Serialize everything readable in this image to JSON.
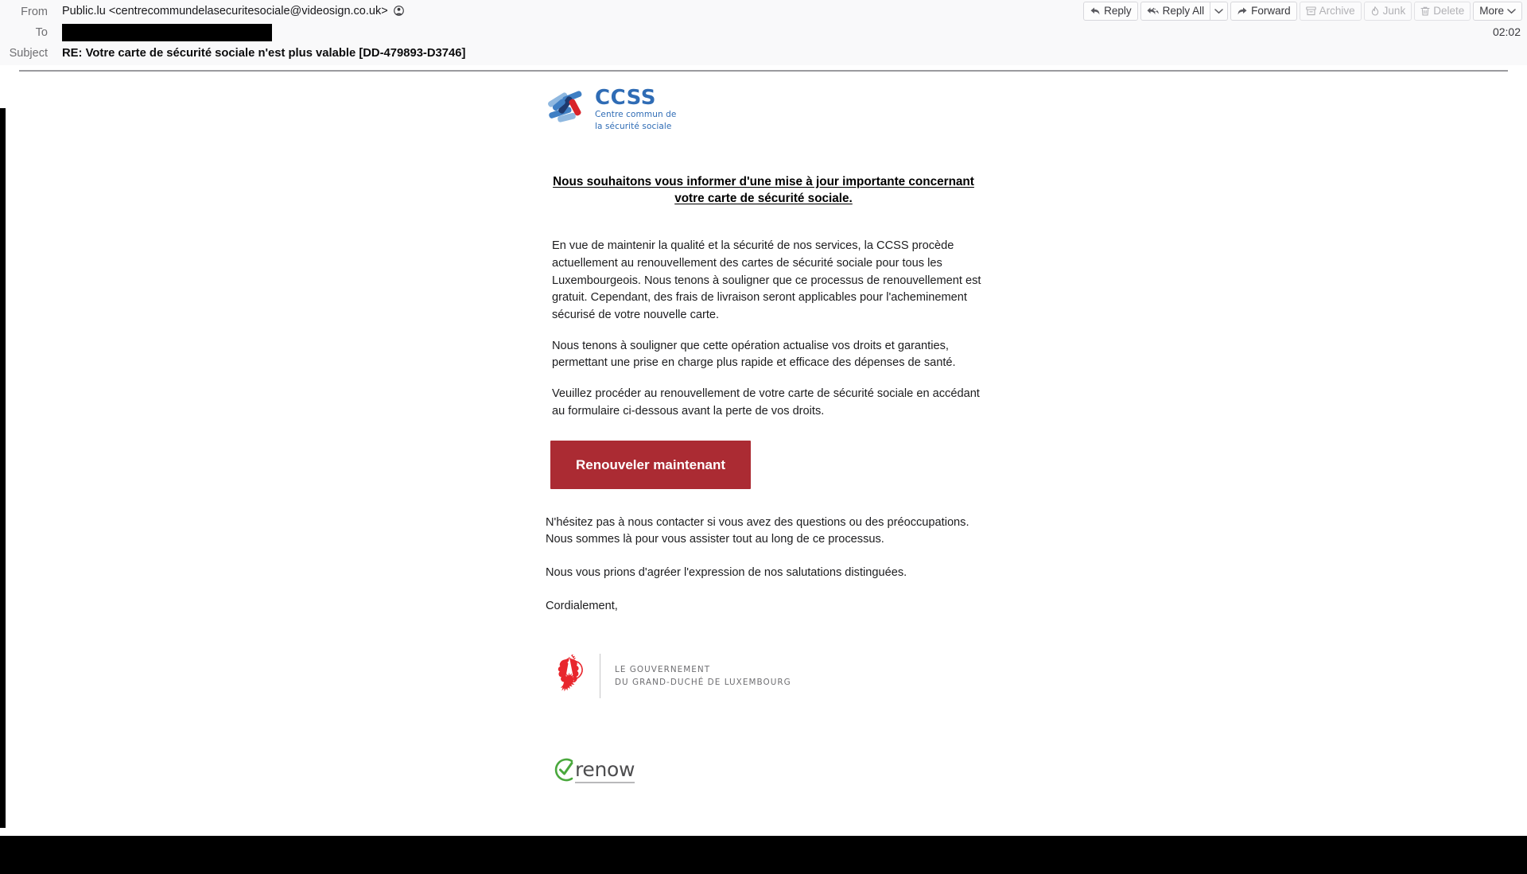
{
  "window": {
    "app": "email-client-message-reader"
  },
  "header": {
    "from_label": "From",
    "from_value": "Public.lu <centrecommundelasecuritesociale@videosign.co.uk>",
    "from_contact_icon": "contact-avatar-icon",
    "to_label": "To",
    "to_value": "",
    "subject_label": "Subject",
    "subject_value": "RE: Votre carte de sécurité sociale n'est plus valable [DD-479893-D3746]",
    "timestamp": "02:02"
  },
  "toolbar": {
    "reply_label": "Reply",
    "reply_icon": "reply-arrow-icon",
    "reply_all_label": "Reply All",
    "reply_all_icon": "reply-all-arrow-icon",
    "reply_all_dropdown_icon": "chevron-down-icon",
    "forward_label": "Forward",
    "forward_icon": "forward-arrow-icon",
    "archive_label": "Archive",
    "archive_icon": "archive-box-icon",
    "archive_disabled": true,
    "junk_label": "Junk",
    "junk_icon": "junk-flame-icon",
    "junk_disabled": true,
    "delete_label": "Delete",
    "delete_icon": "trash-can-icon",
    "delete_disabled": true,
    "more_label": "More",
    "more_icon": "chevron-down-icon"
  },
  "email": {
    "brand_logo": {
      "icon": "ccss-pinwheel-logo-icon",
      "wordmark": "CCSS",
      "tagline_line1": "Centre commun de",
      "tagline_line2": "la sécurité sociale",
      "color": "#2f6cb5"
    },
    "headline": "Nous souhaitons vous informer d'une mise à jour importante concernant votre carte de sécurité sociale.",
    "paragraphs": [
      "En vue de maintenir la qualité et la sécurité de nos services, la CCSS procède actuellement au renouvellement des cartes de sécurité sociale pour tous les Luxembourgeois. Nous tenons à souligner que ce processus de renouvellement est gratuit. Cependant, des frais de livraison seront applicables pour l'acheminement sécurisé de votre nouvelle carte.",
      "Nous tenons à souligner que cette opération actualise vos droits et garanties, permettant une prise en charge plus rapide et efficace des dépenses de santé.",
      "Veuillez procéder au renouvellement de votre carte de sécurité sociale en accédant au formulaire ci-dessous avant la perte de vos droits."
    ],
    "cta": {
      "label": "Renouveler maintenant",
      "color": "#ab2b33"
    },
    "closing_paragraphs": [
      "N'hésitez pas à nous contacter si vous avez des questions ou des préoccupations. Nous sommes là pour vous assister tout au long de ce processus.",
      "Nous vous prions d'agréer l'expression de nos salutations distinguées.",
      "Cordialement,"
    ],
    "gov_logo": {
      "icon": "luxembourg-red-lion-icon",
      "line1": "LE GOUVERNEMENT",
      "line2": "DU GRAND-DUCHÉ DE LUXEMBOURG",
      "color": "#6d6d70"
    },
    "renow_logo": {
      "icon": "green-check-circle-icon",
      "wordmark": "renow",
      "color": "#4aa83d"
    }
  }
}
